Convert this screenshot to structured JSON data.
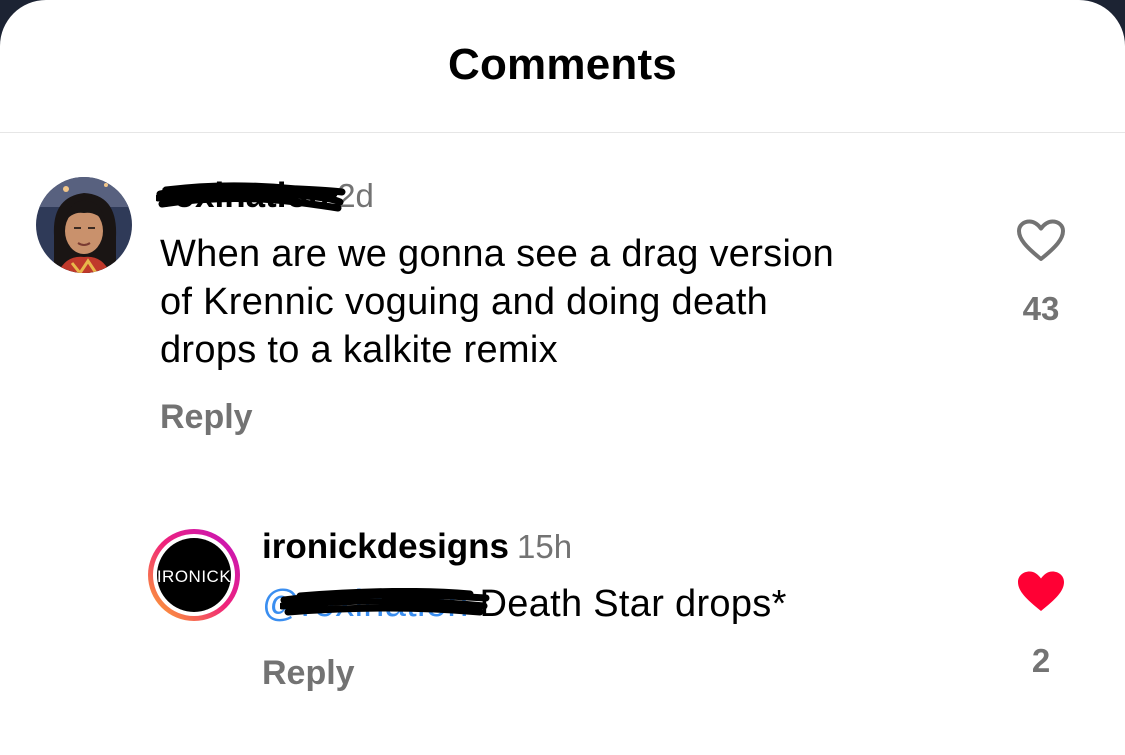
{
  "header": {
    "title": "Comments"
  },
  "comments": [
    {
      "username": "roxination",
      "time": "2d",
      "text_lines": [
        "When are we gonna see a drag version",
        "of Krennic voguing and doing death",
        "drops to a kalkite remix"
      ],
      "reply_label": "Reply",
      "likes": "43",
      "liked": false
    },
    {
      "username": "ironickdesigns",
      "time": "15h",
      "mention": "@roxination",
      "text": "Death Star drops*",
      "reply_label": "Reply",
      "likes": "2",
      "liked": true,
      "avatar_logo_text": "IRONICK"
    }
  ],
  "colors": {
    "like_active": "#ff0034",
    "mention": "#3a8ef0",
    "muted": "#737373"
  }
}
